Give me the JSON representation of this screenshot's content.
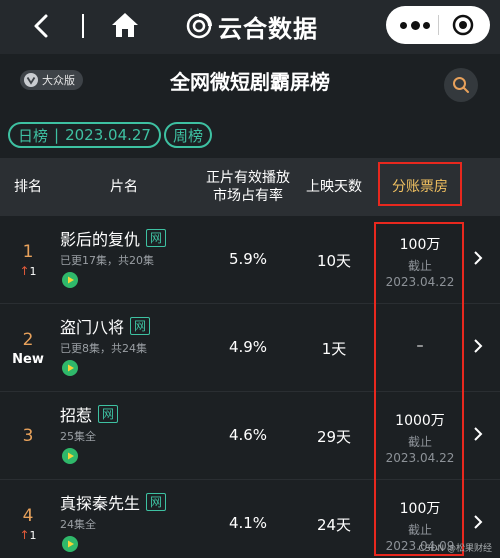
{
  "app": {
    "brand_name": "云合数据",
    "colors": {
      "accent": "#3ec1a2",
      "rank": "#e7a15b",
      "up_arrow": "#e05a3a",
      "highlight": "#e8281e"
    }
  },
  "header": {
    "edition_badge": "大众版",
    "page_title": "全网微短剧霸屏榜"
  },
  "filters": {
    "date_type": "日榜",
    "divider": "|",
    "date": "2023.04.27",
    "period": "周榜"
  },
  "table": {
    "columns": {
      "rank": "排名",
      "name": "片名",
      "share_line1": "正片有效播放",
      "share_line2": "市场占有率",
      "days": "上映天数",
      "box_office": "分账票房"
    },
    "rows": [
      {
        "rank": "1",
        "change_arrow": "↑",
        "change": "1",
        "title": "影后的复仇",
        "badge": "网",
        "episodes": "已更17集，共20集",
        "share": "5.9%",
        "days": "10天",
        "box_office": "100万",
        "note_label": "截止",
        "note_date": "2023.04.22"
      },
      {
        "rank": "2",
        "change_arrow": "",
        "change": "New",
        "title": "盗门八将",
        "badge": "网",
        "episodes": "已更8集，共24集",
        "share": "4.9%",
        "days": "1天",
        "box_office": "–",
        "note_label": "",
        "note_date": ""
      },
      {
        "rank": "3",
        "change_arrow": "",
        "change": "",
        "title": "招惹",
        "badge": "网",
        "episodes": "25集全",
        "share": "4.6%",
        "days": "29天",
        "box_office": "1000万",
        "note_label": "截止",
        "note_date": "2023.04.22"
      },
      {
        "rank": "4",
        "change_arrow": "↑",
        "change": "1",
        "title": "真探秦先生",
        "badge": "网",
        "episodes": "24集全",
        "share": "4.1%",
        "days": "24天",
        "box_office": "100万",
        "note_label": "截止",
        "note_date": "2023.04.09"
      }
    ]
  },
  "watermark": "CSDN @松果财经"
}
